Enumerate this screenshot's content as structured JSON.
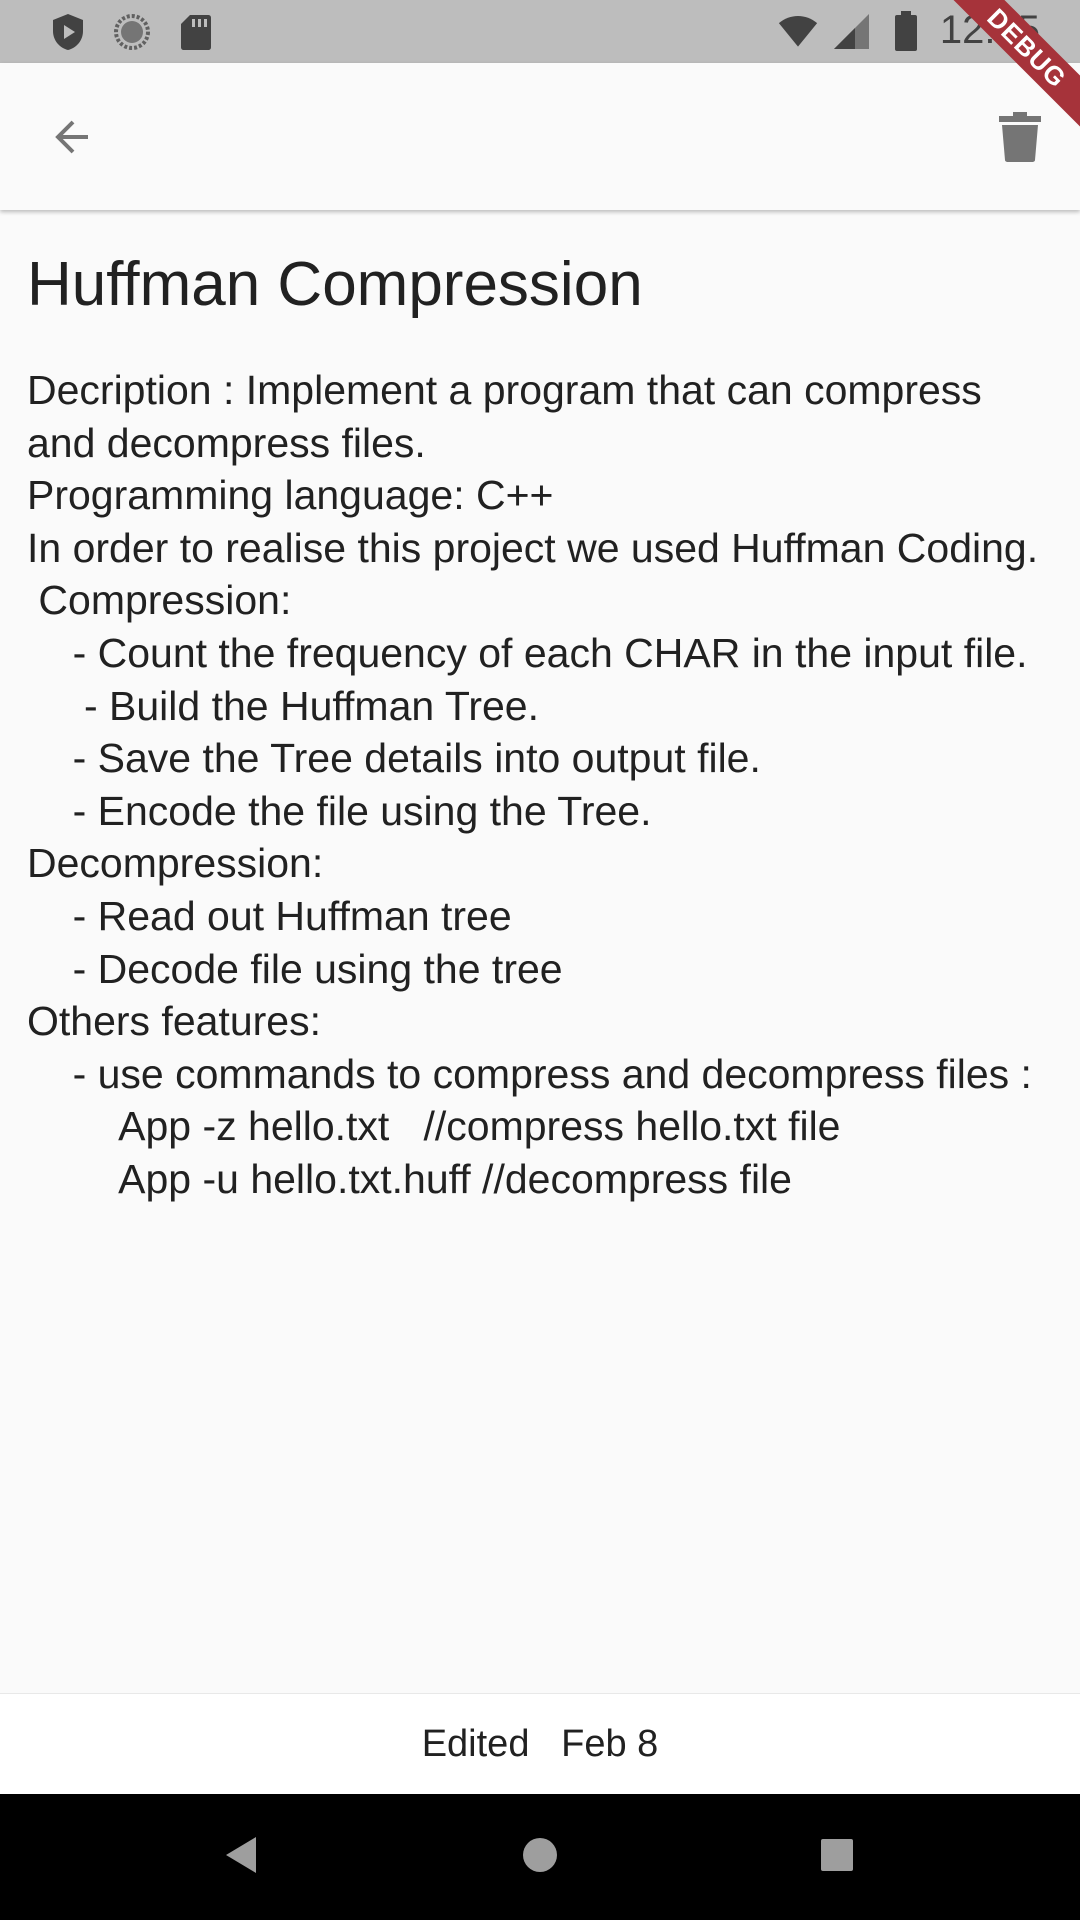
{
  "status_bar": {
    "time": "12:05",
    "left_icons": [
      "shield-icon",
      "sync-icon",
      "sd-card-icon"
    ],
    "right_icons": [
      "wifi-icon",
      "cell-signal-icon",
      "battery-icon"
    ]
  },
  "app_bar": {
    "back_icon": "arrow-back-icon",
    "delete_icon": "trash-icon"
  },
  "debug_banner": "DEBUG",
  "note": {
    "title": "Huffman Compression",
    "body": "Decription : Implement a program that can compress and decompress files.\nProgramming language: C++\nIn order to realise this project we used Huffman Coding.\n Compression:\n    - Count the frequency of each CHAR in the input file.\n     - Build the Huffman Tree.\n    - Save the Tree details into output file.\n    - Encode the file using the Tree.\nDecompression:\n    - Read out Huffman tree\n    - Decode file using the tree\nOthers features:\n    - use commands to compress and decompress files :\n        App -z hello.txt   //compress hello.txt file\n        App -u hello.txt.huff //decompress file"
  },
  "footer": {
    "edited_label": "Edited   Feb 8"
  },
  "nav_bar": {
    "icons": [
      "back-triangle-icon",
      "home-circle-icon",
      "recents-square-icon"
    ]
  },
  "colors": {
    "status_bar": "#bdbdbd",
    "background": "#fafafa",
    "text": "#212121",
    "icon_grey": "#757575",
    "debug_banner": "#a6333a",
    "nav_bar": "#000000"
  }
}
